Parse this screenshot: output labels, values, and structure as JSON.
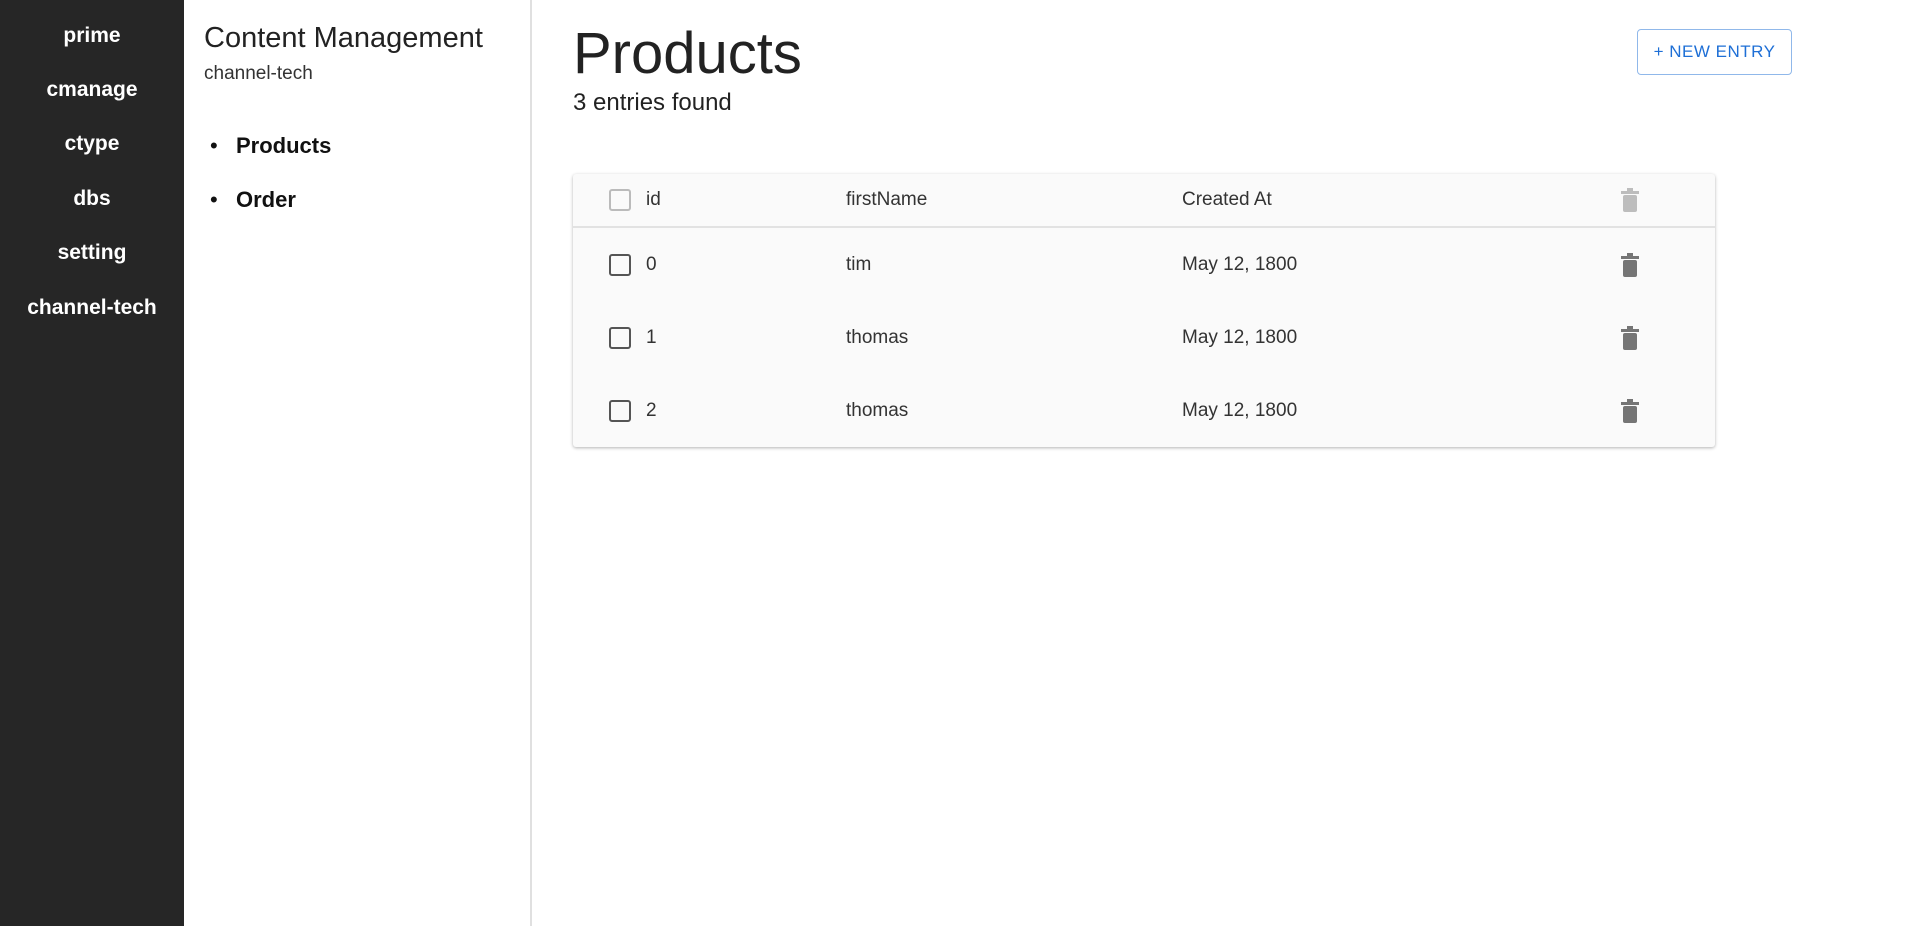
{
  "nav": {
    "items": [
      "prime",
      "cmanage",
      "ctype",
      "dbs",
      "setting",
      "channel-tech"
    ]
  },
  "panel": {
    "title": "Content Management",
    "subtitle": "channel-tech",
    "items": [
      "Products",
      "Order"
    ]
  },
  "main": {
    "title": "Products",
    "count_text": "3 entries found",
    "new_entry_label": "+ NEW ENTRY"
  },
  "table": {
    "columns": [
      "id",
      "firstName",
      "Created At"
    ],
    "rows": [
      {
        "id": "0",
        "firstName": "tim",
        "createdAt": "May 12, 1800"
      },
      {
        "id": "1",
        "firstName": "thomas",
        "createdAt": "May 12, 1800"
      },
      {
        "id": "2",
        "firstName": "thomas",
        "createdAt": "May 12, 1800"
      }
    ]
  },
  "colors": {
    "sidebar": "#262626",
    "accent": "#1e6fd6",
    "trash": "#757575",
    "trash_disabled": "#bdbdbd"
  },
  "icons": {
    "delete": "trash-icon",
    "select": "checkbox-icon"
  }
}
